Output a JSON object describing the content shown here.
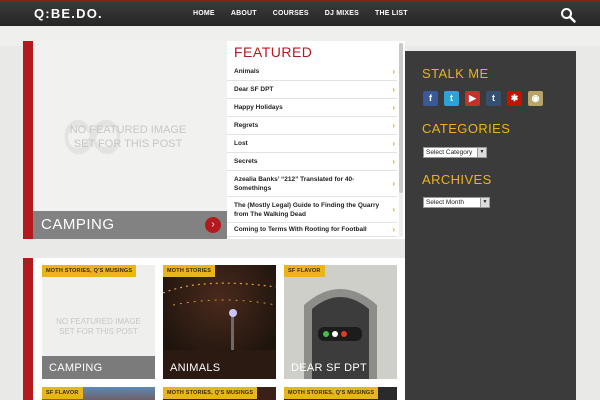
{
  "header": {
    "logo": "Q:BE.DO.",
    "nav": [
      "HOME",
      "ABOUT",
      "COURSES",
      "DJ MIXES",
      "THE LIST"
    ],
    "search_icon": "search-icon"
  },
  "hero": {
    "placeholder": "NO FEATURED IMAGE SET FOR THIS POST",
    "title": "CAMPING"
  },
  "featured": {
    "heading": "FEATURED",
    "items": [
      "Animals",
      "Dear SF DPT",
      "Happy Holidays",
      "Regrets",
      "Lost",
      "Secrets",
      "Azealia Banks’ “212” Translated for 40-Somethings",
      "The (Mostly Legal) Guide to Finding the Quarry from The Walking Dead",
      "Coming to Terms With Rooting for Football"
    ]
  },
  "sidebar": {
    "stalk_heading": "STALK ME",
    "social": [
      "facebook-icon",
      "twitter-icon",
      "youtube-icon",
      "tumblr-icon",
      "yelp-icon",
      "lastfm-icon"
    ],
    "categories_heading": "CATEGORIES",
    "categories_select": "Select Category",
    "archives_heading": "ARCHIVES",
    "archives_select": "Select Month"
  },
  "cards": [
    {
      "tag": "MOTH STORIES, Q'S MUSINGS",
      "title": "CAMPING",
      "placeholder": "NO FEATURED IMAGE SET FOR THIS POST"
    },
    {
      "tag": "MOTH STORIES",
      "title": "ANIMALS"
    },
    {
      "tag": "SF FLAVOR",
      "title": "DEAR SF DPT"
    },
    {
      "tag": "SF FLAVOR",
      "title": ""
    },
    {
      "tag": "MOTH STORIES, Q'S MUSINGS",
      "title": ""
    },
    {
      "tag": "MOTH STORIES, Q'S MUSINGS",
      "title": ""
    }
  ],
  "colors": {
    "brand_red": "#b3191d",
    "accent_gold": "#e8b51c",
    "sidebar_bg": "#3b3b3b",
    "header_bg": "#2e2e2e"
  }
}
